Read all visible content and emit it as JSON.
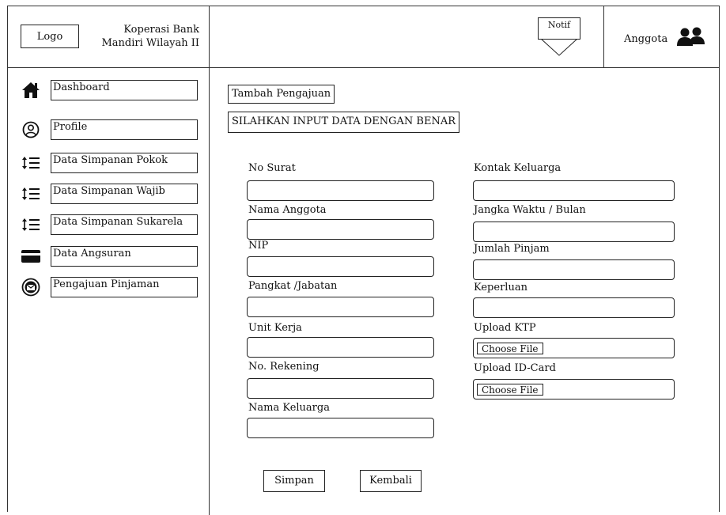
{
  "header": {
    "logo_label": "Logo",
    "brand_line1": "Koperasi Bank",
    "brand_line2": "Mandiri Wilayah II",
    "notif_label": "Notif",
    "user_label": "Anggota"
  },
  "sidebar": {
    "items": [
      {
        "label": "Dashboard",
        "icon": "home-icon"
      },
      {
        "label": "Profile",
        "icon": "user-circle-icon"
      },
      {
        "label": "Data Simpanan Pokok",
        "icon": "sort-list-icon"
      },
      {
        "label": "Data Simpanan Wajib",
        "icon": "sort-list-icon"
      },
      {
        "label": "Data Simpanan Sukarela",
        "icon": "sort-list-icon"
      },
      {
        "label": "Data Angsuran",
        "icon": "card-icon"
      },
      {
        "label": "Pengajuan Pinjaman",
        "icon": "envelope-circle-icon"
      }
    ]
  },
  "main": {
    "title": "Tambah Pengajuan",
    "notice": "SILAHKAN INPUT DATA DENGAN BENAR",
    "form": {
      "left": [
        {
          "label": "No Surat",
          "value": ""
        },
        {
          "label": "Nama Anggota",
          "value": ""
        },
        {
          "label": "NIP",
          "value": ""
        },
        {
          "label": "Pangkat /Jabatan",
          "value": ""
        },
        {
          "label": "Unit Kerja",
          "value": ""
        },
        {
          "label": "No. Rekening",
          "value": ""
        },
        {
          "label": "Nama Keluarga",
          "value": ""
        }
      ],
      "right": [
        {
          "label": "Kontak Keluarga",
          "value": ""
        },
        {
          "label": "Jangka Waktu / Bulan",
          "value": ""
        },
        {
          "label": "Jumlah Pinjam",
          "value": ""
        },
        {
          "label": "Keperluan",
          "value": ""
        }
      ],
      "uploads": [
        {
          "label": "Upload KTP",
          "button": "Choose File"
        },
        {
          "label": "Upload ID-Card",
          "button": "Choose File"
        }
      ]
    },
    "save_label": "Simpan",
    "back_label": "Kembali"
  }
}
